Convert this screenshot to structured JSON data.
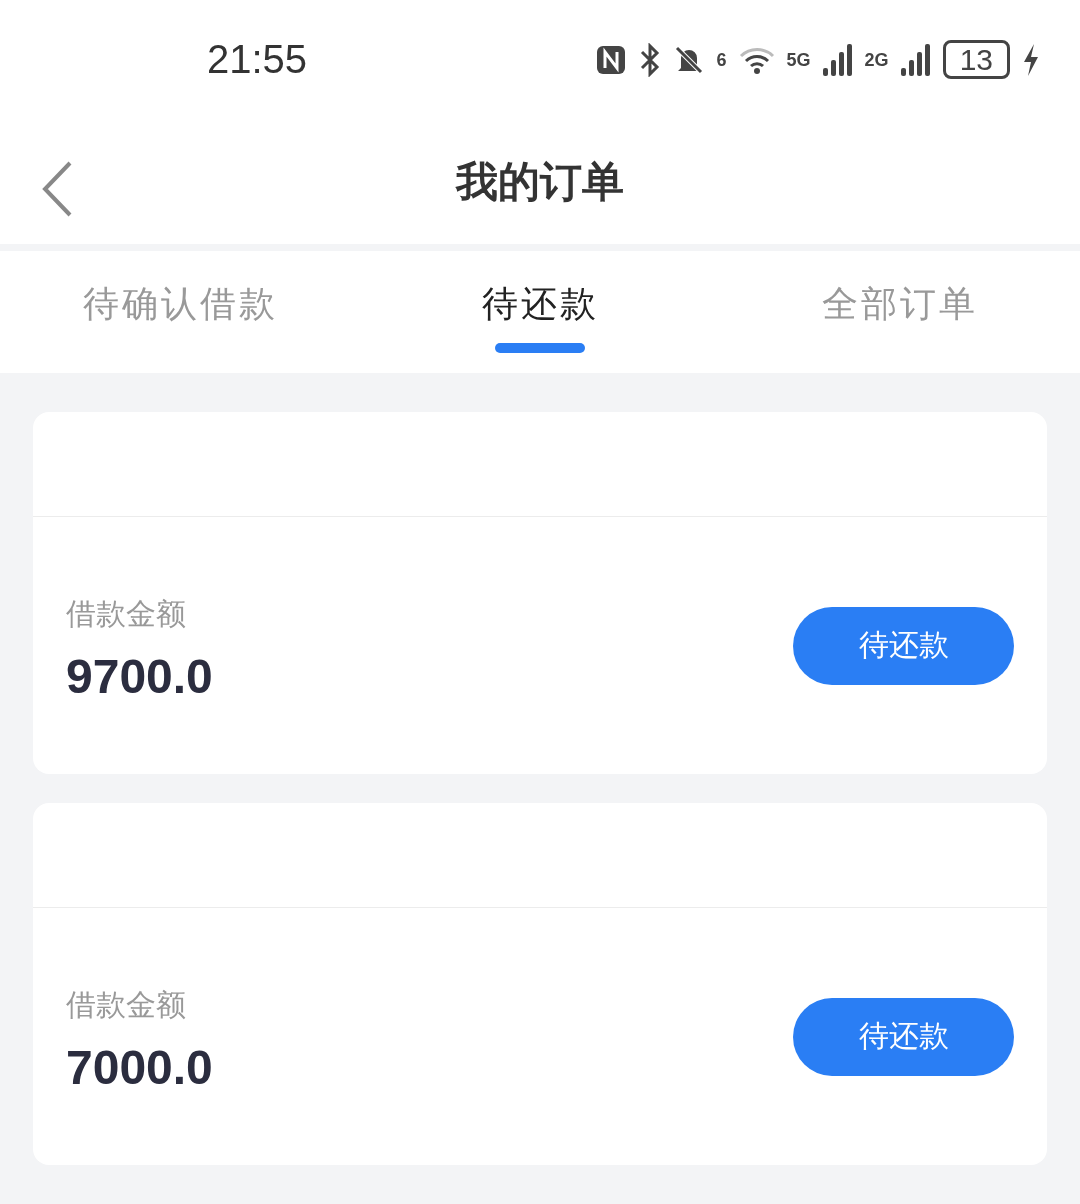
{
  "status_bar": {
    "time": "21:55",
    "wifi_label": "6",
    "network_1": "5G",
    "network_2": "2G",
    "battery": "13"
  },
  "nav": {
    "title": "我的订单"
  },
  "tabs": [
    {
      "label": "待确认借款",
      "selected": false
    },
    {
      "label": "待还款",
      "selected": true
    },
    {
      "label": "全部订单",
      "selected": false
    }
  ],
  "orders": [
    {
      "label": "借款金额",
      "amount": "9700.0",
      "button": "待还款"
    },
    {
      "label": "借款金额",
      "amount": "7000.0",
      "button": "待还款"
    }
  ]
}
